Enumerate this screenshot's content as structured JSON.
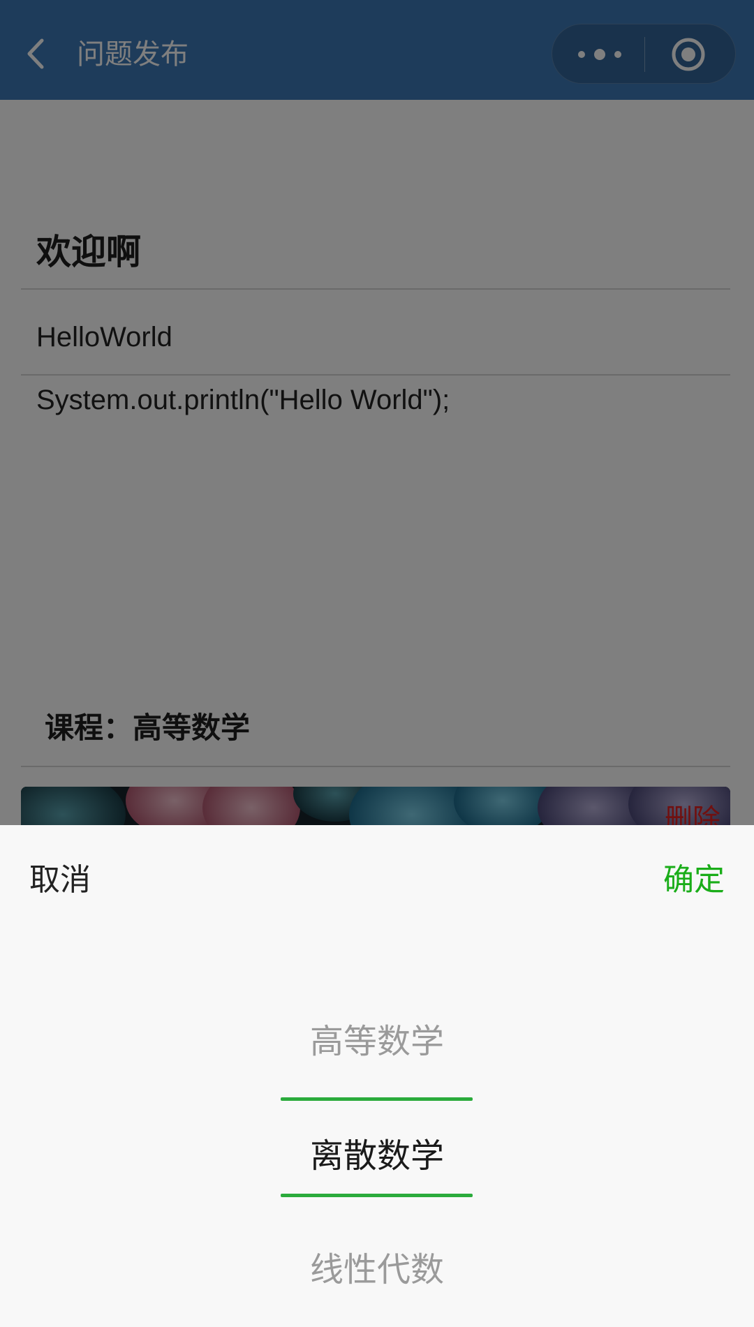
{
  "navbar": {
    "title": "问题发布",
    "back_icon": "chevron-left-icon",
    "more_icon": "more-dots-icon",
    "close_icon": "target-circle-icon",
    "background": "#3d78b6"
  },
  "question": {
    "title": "欢迎啊",
    "subtitle": "HelloWorld",
    "body": "System.out.println(\"Hello World\");",
    "course_line": "课程：高等数学",
    "delete_label": "删除"
  },
  "picker": {
    "cancel_label": "取消",
    "confirm_label": "确定",
    "confirm_color": "#1aad19",
    "options": [
      "高等数学",
      "离散数学",
      "线性代数"
    ],
    "selected": "离散数学"
  }
}
